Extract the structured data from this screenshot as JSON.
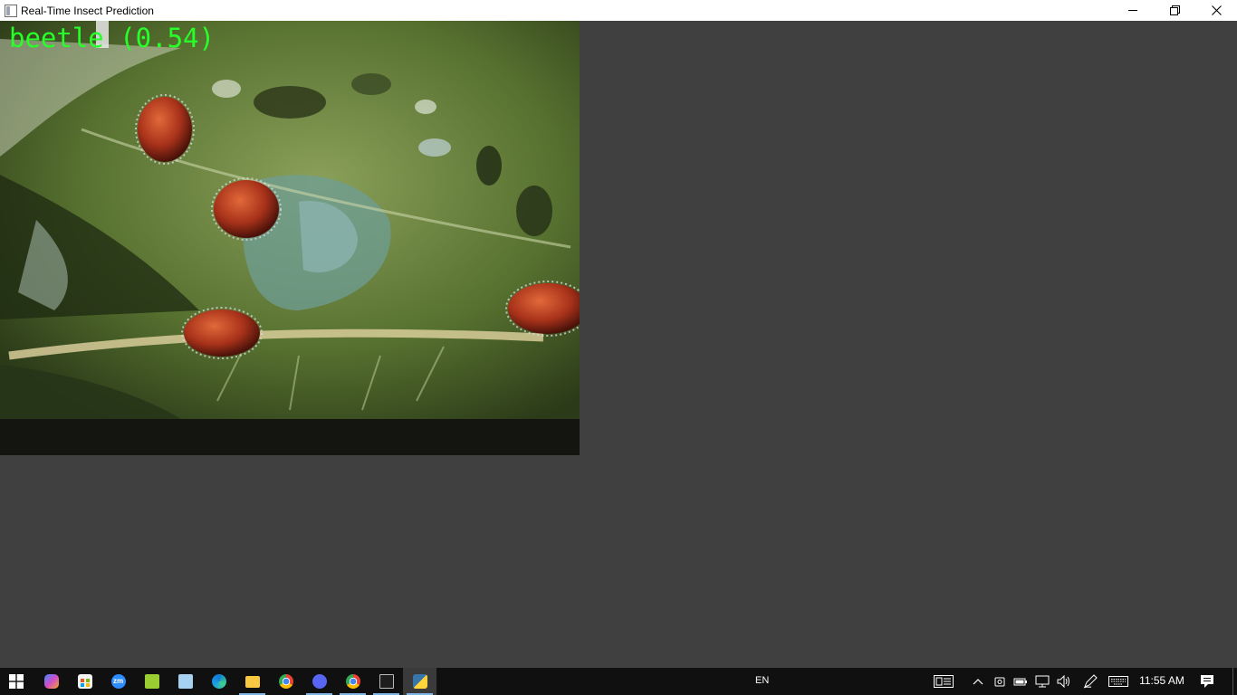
{
  "window": {
    "title": "Real-Time Insect Prediction",
    "controls": [
      "minimize-icon",
      "restore-icon",
      "close-icon"
    ]
  },
  "video": {
    "overlay_label": "beetle (0.54)",
    "overlay_color": "#27ff2b"
  },
  "taskbar": {
    "start_icon": "windows-logo-icon",
    "apps": [
      {
        "name": "copilot",
        "icon": "copilot-icon"
      },
      {
        "name": "microsoft-store",
        "icon": "store-icon"
      },
      {
        "name": "zoom",
        "icon": "zoom-icon",
        "text": "zm"
      },
      {
        "name": "photo-app",
        "icon": "photo-icon"
      },
      {
        "name": "notepad",
        "icon": "notepad-icon"
      },
      {
        "name": "edge",
        "icon": "edge-icon"
      },
      {
        "name": "file-explorer",
        "icon": "folder-icon",
        "active": true
      },
      {
        "name": "chrome",
        "icon": "chrome-icon"
      },
      {
        "name": "discord",
        "icon": "discord-icon",
        "active": true
      },
      {
        "name": "chrome-profile",
        "icon": "chrome-icon",
        "active": true
      },
      {
        "name": "command-prompt",
        "icon": "terminal-icon",
        "active": true
      },
      {
        "name": "python",
        "icon": "python-icon",
        "active": true,
        "focused": true
      }
    ],
    "language": "EN",
    "tray_icons": [
      "news-icon",
      "chevron-up-icon",
      "camera-icon",
      "battery-icon",
      "network-icon",
      "volume-icon",
      "pen-icon",
      "keyboard-icon"
    ],
    "time": "11:55 AM",
    "notification_icon": "notification-icon"
  }
}
